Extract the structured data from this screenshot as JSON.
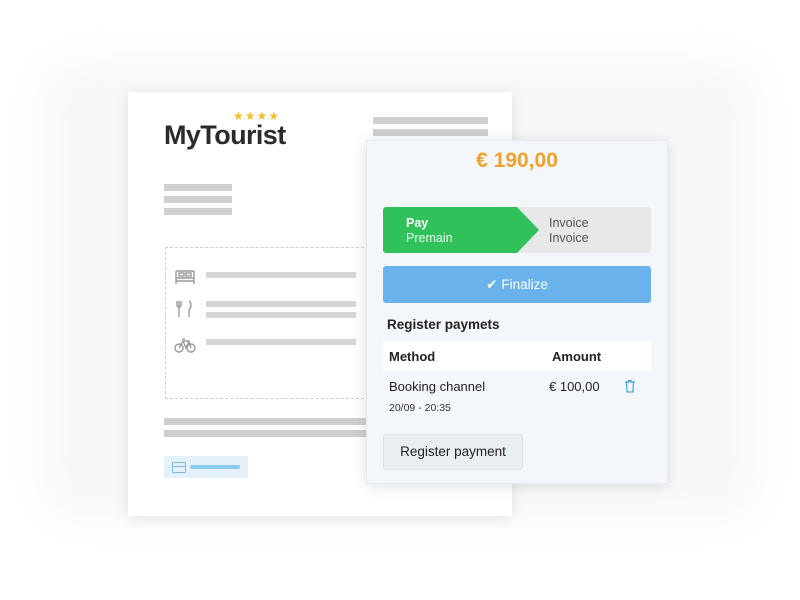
{
  "brand": {
    "name": "MyTourist",
    "stars": "★★★★"
  },
  "payment": {
    "total": "€ 190,00",
    "steps": {
      "pay": {
        "title": "Pay",
        "subtitle": "Premain"
      },
      "invoice": {
        "title": "Invoice",
        "subtitle": "Invoice"
      }
    },
    "finalize": {
      "icon": "check-icon",
      "label": "Finalize"
    },
    "section_title": "Register paymets",
    "table": {
      "headers": [
        "Method",
        "Amount"
      ],
      "rows": [
        {
          "method": "Booking channel",
          "date": "20/09 - 20:35",
          "amount": "€ 100,00",
          "action_icon": "trash-icon"
        }
      ]
    },
    "register_button": "Register payment"
  },
  "colors": {
    "accent_orange": "#f0a12c",
    "step_green": "#30c15a",
    "finalize_blue": "#69b2ec",
    "panel_bg": "#f3f7fb"
  },
  "doc_icons": [
    "bed-icon",
    "fork-knife-icon",
    "bicycle-icon",
    "card-icon"
  ]
}
